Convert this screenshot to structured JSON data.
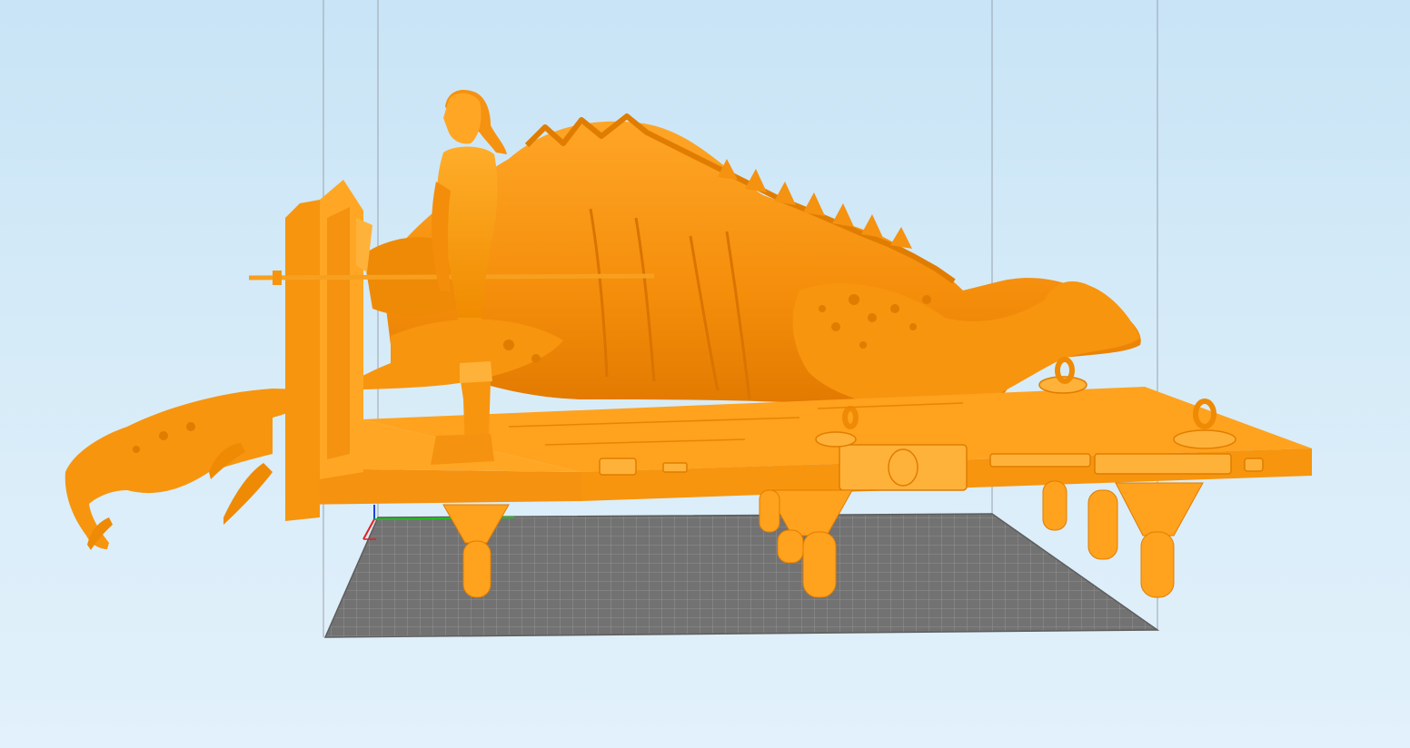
{
  "viewport": {
    "kind": "3d-print-slicer-viewport",
    "background_top": "#c8e4f6",
    "background_bottom": "#e2f1fb"
  },
  "build_plate": {
    "grid_color": "#8a8a8a",
    "plate_color": "#6e6e6e",
    "volume_edge_color": "#9aa3ad"
  },
  "model": {
    "color": "#ffa31a",
    "shade_color": "#e07d00",
    "highlight_color": "#ffc04d"
  },
  "axes": {
    "x_color": "#e02020",
    "y_color": "#20c020",
    "z_color": "#2040e0"
  }
}
